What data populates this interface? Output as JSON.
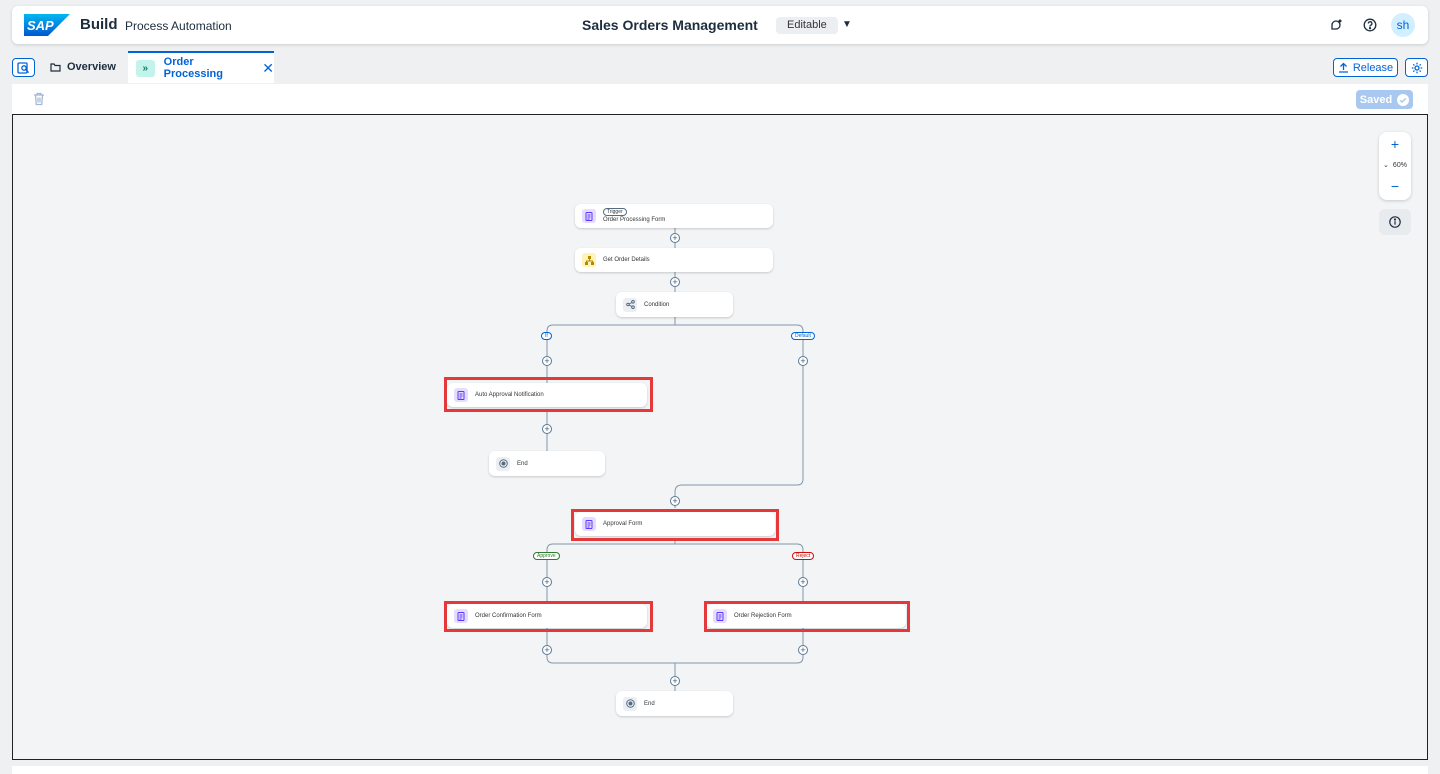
{
  "shell": {
    "logo_text": "SAP",
    "brand": "Build",
    "product": "Process Automation",
    "project_title": "Sales Orders Management",
    "status": "Editable",
    "avatar_initials": "sh",
    "icons": [
      "notifications-icon",
      "help-icon"
    ]
  },
  "tabs": {
    "overview_label": "Overview",
    "active_label": "Order Processing"
  },
  "actions": {
    "release_label": "Release",
    "saved_label": "Saved"
  },
  "canvas": {
    "zoom_level": "60%",
    "nodes": {
      "trigger_pill": "Trigger",
      "order_processing_form": "Order Processing Form",
      "get_order_details": "Get Order Details",
      "condition": "Condition",
      "auto_approval_notification": "Auto Approval Notification",
      "end_1": "End",
      "approval_form": "Approval Form",
      "order_confirmation_form": "Order Confirmation Form",
      "order_rejection_form": "Order Rejection Form",
      "end_2": "End"
    },
    "branches": {
      "if_label": "If",
      "default_label": "Default",
      "approve_label": "Approve",
      "reject_label": "Reject"
    }
  },
  "colors": {
    "accent": "#0064d9",
    "highlight": "#e5383b",
    "approve": "#2b7c2b",
    "reject": "#d20a0a"
  }
}
